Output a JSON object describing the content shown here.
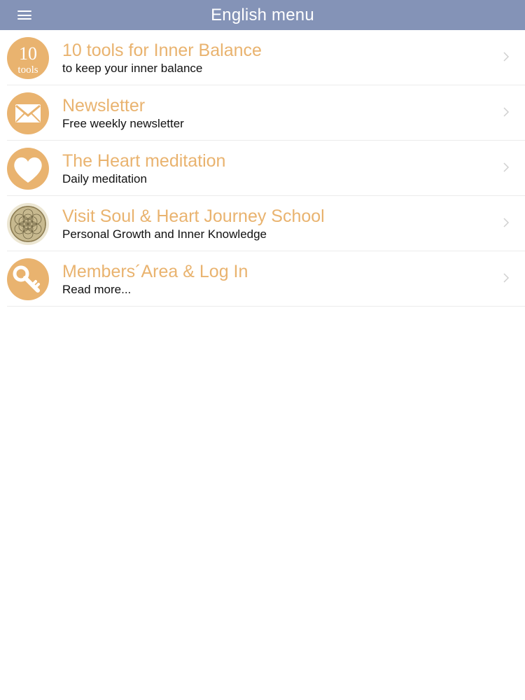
{
  "header": {
    "title": "English menu",
    "menu_icon": "hamburger-icon"
  },
  "accent_color": "#e9b36f",
  "header_color": "#8493b7",
  "items": [
    {
      "title": "10 tools for Inner Balance",
      "subtitle": "to keep your inner balance",
      "icon": "ten-tools-icon",
      "icon_text_top": "10",
      "icon_text_bottom": "tools"
    },
    {
      "title": "Newsletter",
      "subtitle": "Free weekly newsletter",
      "icon": "envelope-icon"
    },
    {
      "title": "The Heart meditation",
      "subtitle": "Daily meditation",
      "icon": "heart-icon"
    },
    {
      "title": "Visit Soul & Heart Journey School",
      "subtitle": "Personal Growth and Inner Knowledge",
      "icon": "flower-of-life-icon"
    },
    {
      "title": "Members´Area & Log In",
      "subtitle": "Read more...",
      "icon": "key-icon"
    }
  ]
}
